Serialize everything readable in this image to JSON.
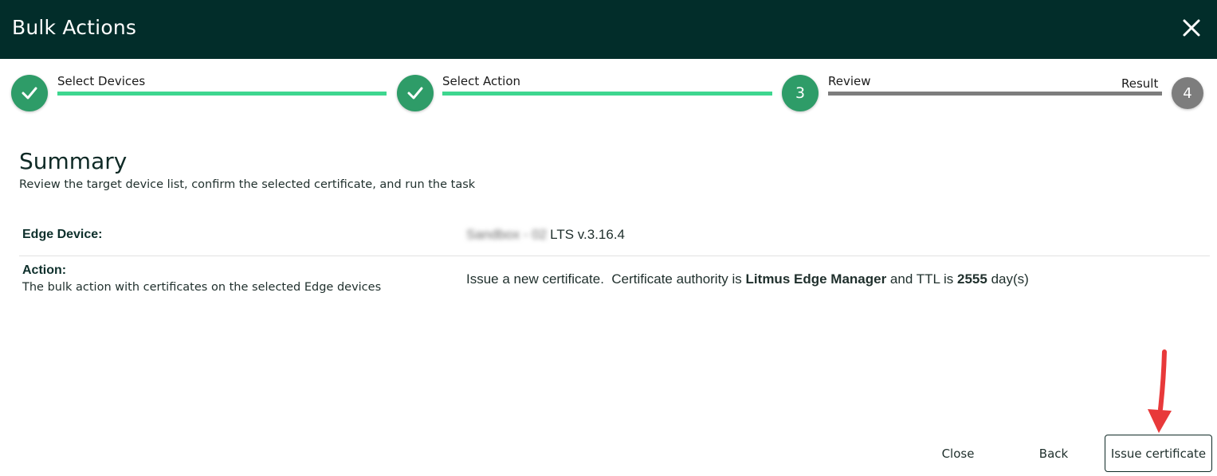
{
  "dialog": {
    "title": "Bulk Actions"
  },
  "stepper": {
    "steps": [
      {
        "label": "Select Devices",
        "state": "done",
        "number": "1"
      },
      {
        "label": "Select Action",
        "state": "done",
        "number": "2"
      },
      {
        "label": "Review",
        "state": "active",
        "number": "3"
      },
      {
        "label": "Result",
        "state": "pending",
        "number": "4"
      }
    ]
  },
  "summary": {
    "title": "Summary",
    "subtitle": "Review the target device list, confirm the selected certificate, and run the task"
  },
  "details": {
    "edge_device": {
      "label": "Edge Device:",
      "value_blurred": "Sandbox - 02",
      "value_version": "LTS v.3.16.4"
    },
    "action": {
      "label": "Action:",
      "description": "The bulk action with certificates on the selected Edge devices",
      "value_prefix": "Issue a new certificate.  Certificate authority is ",
      "authority": "Litmus Edge Manager",
      "value_middle": " and TTL is ",
      "ttl": "2555",
      "value_suffix": " day(s)"
    }
  },
  "footer": {
    "close_label": "Close",
    "back_label": "Back",
    "issue_label": "Issue certificate"
  },
  "colors": {
    "header_bg": "#022d2a",
    "step_done": "#2e9c68",
    "bar_done": "#3ed68f",
    "step_pending": "#7d7d7d",
    "annotation_arrow": "#e8393a"
  },
  "icons": {
    "close": "close-icon",
    "check": "check-icon",
    "annotation": "red-arrow-annotation"
  }
}
